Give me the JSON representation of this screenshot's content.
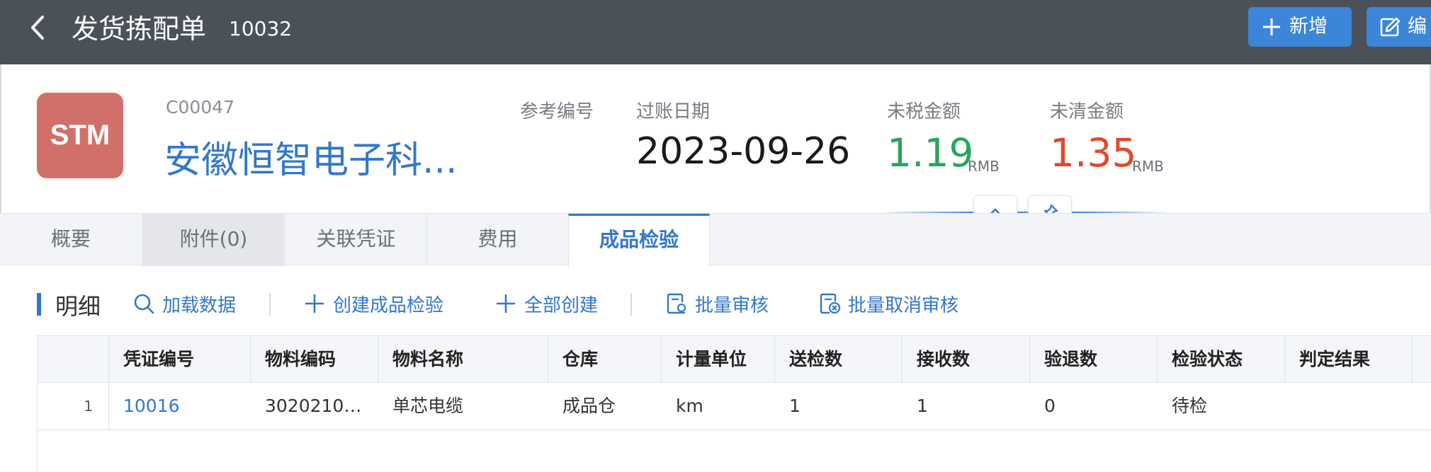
{
  "header": {
    "title": "发货拣配单",
    "doc_number": "10032",
    "buttons": {
      "new_label": "新增",
      "edit_label": "编"
    }
  },
  "info": {
    "avatar_text": "STM",
    "customer_code": "C00047",
    "customer_name": "安徽恒智电子科...",
    "ref_label": "参考编号",
    "ref_value": "",
    "date_label": "过账日期",
    "date_value": "2023-09-26",
    "untaxed_label": "未税金额",
    "untaxed_value": "1.19",
    "untaxed_currency": "RMB",
    "outstanding_label": "未清金额",
    "outstanding_value": "1.35",
    "outstanding_currency": "RMB"
  },
  "tabs": [
    {
      "label": "概要"
    },
    {
      "label": "附件(0)"
    },
    {
      "label": "关联凭证"
    },
    {
      "label": "费用"
    },
    {
      "label": "成品检验"
    }
  ],
  "active_tab": "成品检验",
  "section": {
    "title": "明细",
    "tools": {
      "load": "加载数据",
      "create": "创建成品检验",
      "create_all": "全部创建",
      "batch_approve": "批量审核",
      "batch_cancel": "批量取消审核"
    }
  },
  "table": {
    "columns": [
      "凭证编号",
      "物料编码",
      "物料名称",
      "仓库",
      "计量单位",
      "送检数",
      "接收数",
      "验退数",
      "检验状态",
      "判定结果",
      ""
    ],
    "rows": [
      {
        "index": "1",
        "voucher_no": "10016",
        "material_code": "3020210…",
        "material_name": "单芯电缆",
        "warehouse": "成品仓",
        "unit": "km",
        "sent_qty": "1",
        "received_qty": "1",
        "returned_qty": "0",
        "status": "待检",
        "result": ""
      }
    ]
  },
  "colors": {
    "topbar": "#4a5159",
    "primary": "#3b86d9",
    "link": "#3377cc",
    "avatar": "#d1706a",
    "amount_green": "#26a65b",
    "amount_red": "#e0492b"
  },
  "icons": {
    "back": "chevron-left-icon",
    "new": "plus-icon",
    "edit": "edit-icon",
    "collapse": "chevron-up-icon",
    "pin": "pin-icon",
    "load": "search-icon",
    "create": "plus-icon",
    "create_all": "plus-icon",
    "batch_approve": "approve-doc-icon",
    "batch_cancel": "cancel-approve-doc-icon"
  }
}
